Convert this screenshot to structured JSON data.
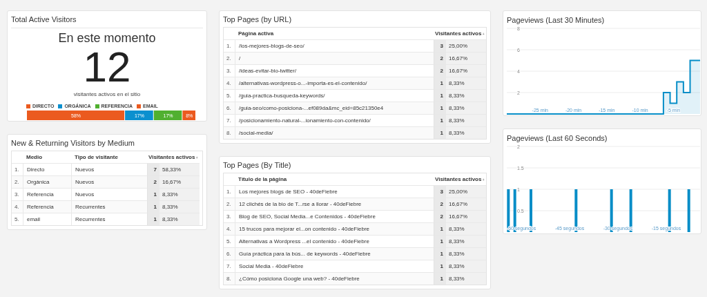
{
  "total_active": {
    "title": "Total Active Visitors",
    "heading": "En este momento",
    "count": "12",
    "caption": "visitantes activos en el sitio",
    "chart_data": {
      "type": "bar",
      "orientation": "horizontal",
      "stacked": true,
      "series": [
        {
          "name": "DIRECTO",
          "color": "#eb5a1f",
          "values": [
            58
          ],
          "value_labels": [
            "58%"
          ]
        },
        {
          "name": "ORGÁNICA",
          "color": "#0b90cf",
          "values": [
            17
          ],
          "value_labels": [
            "17%"
          ]
        },
        {
          "name": "REFERENCIA",
          "color": "#50b030",
          "values": [
            17
          ],
          "value_labels": [
            "17%"
          ]
        },
        {
          "name": "EMAIL",
          "color": "#eb5a1f",
          "values": [
            8
          ],
          "value_labels": [
            "8%"
          ]
        }
      ]
    }
  },
  "by_medium": {
    "title": "New & Returning Visitors by Medium",
    "columns": [
      "Medio",
      "Tipo de visitante",
      "Visitantes activos"
    ],
    "rows": [
      {
        "index": "1.",
        "cells": [
          "Directo",
          "Nuevos"
        ],
        "count": "7",
        "percent": "58,33%"
      },
      {
        "index": "2.",
        "cells": [
          "Orgánica",
          "Nuevos"
        ],
        "count": "2",
        "percent": "16,67%"
      },
      {
        "index": "3.",
        "cells": [
          "Referencia",
          "Nuevos"
        ],
        "count": "1",
        "percent": "8,33%"
      },
      {
        "index": "4.",
        "cells": [
          "Referencia",
          "Recurrentes"
        ],
        "count": "1",
        "percent": "8,33%"
      },
      {
        "index": "5.",
        "cells": [
          "email",
          "Recurrentes"
        ],
        "count": "1",
        "percent": "8,33%"
      }
    ]
  },
  "top_pages_url": {
    "title": "Top Pages (by URL)",
    "columns": [
      "Página activa",
      "Visitantes activos"
    ],
    "rows": [
      {
        "index": "1.",
        "cells": [
          "/los-mejores-blogs-de-seo/"
        ],
        "count": "3",
        "percent": "25,00%"
      },
      {
        "index": "2.",
        "cells": [
          "/"
        ],
        "count": "2",
        "percent": "16,67%"
      },
      {
        "index": "3.",
        "cells": [
          "/ideas-evitar-bio-twitter/"
        ],
        "count": "2",
        "percent": "16,67%"
      },
      {
        "index": "4.",
        "cells": [
          "/alternativas-wordpress-o...-importa-es-el-contenido/"
        ],
        "count": "1",
        "percent": "8,33%"
      },
      {
        "index": "5.",
        "cells": [
          "/guia-practica-busqueda-keywords/"
        ],
        "count": "1",
        "percent": "8,33%"
      },
      {
        "index": "6.",
        "cells": [
          "/guia-seo/como-posiciona-...ef089da&mc_eid=85c21350e4"
        ],
        "count": "1",
        "percent": "8,33%"
      },
      {
        "index": "7.",
        "cells": [
          "/posicionamiento-natural-...ionamiento-con-contenido/"
        ],
        "count": "1",
        "percent": "8,33%"
      },
      {
        "index": "8.",
        "cells": [
          "/social-media/"
        ],
        "count": "1",
        "percent": "8,33%"
      }
    ]
  },
  "top_pages_title": {
    "title": "Top Pages (By Title)",
    "columns": [
      "Título de la página",
      "Visitantes activos"
    ],
    "rows": [
      {
        "index": "1.",
        "cells": [
          "Los mejores blogs de SEO - 40deFiebre"
        ],
        "count": "3",
        "percent": "25,00%"
      },
      {
        "index": "2.",
        "cells": [
          "12 clichés de la bio de T...rse a llorar - 40deFiebre"
        ],
        "count": "2",
        "percent": "16,67%"
      },
      {
        "index": "3.",
        "cells": [
          "Blog de SEO, Social Media...e Contenidos - 40deFiebre"
        ],
        "count": "2",
        "percent": "16,67%"
      },
      {
        "index": "4.",
        "cells": [
          "15 trucos para mejorar el...on contenido - 40deFiebre"
        ],
        "count": "1",
        "percent": "8,33%"
      },
      {
        "index": "5.",
        "cells": [
          "Alternativas a Wordpress ...el contenido - 40deFiebre"
        ],
        "count": "1",
        "percent": "8,33%"
      },
      {
        "index": "6.",
        "cells": [
          "Guía práctica para la bús... de keywords - 40deFiebre"
        ],
        "count": "1",
        "percent": "8,33%"
      },
      {
        "index": "7.",
        "cells": [
          "Social Media - 40deFiebre"
        ],
        "count": "1",
        "percent": "8,33%"
      },
      {
        "index": "8.",
        "cells": [
          "¿Cómo posiciona Google una web? - 40deFiebre"
        ],
        "count": "1",
        "percent": "8,33%"
      }
    ]
  },
  "pageviews_30_min": {
    "title": "Pageviews (Last 30 Minutes)",
    "chart_data": {
      "type": "area",
      "xlim": [
        -30,
        -1
      ],
      "ylim": [
        0,
        8
      ],
      "grid": true,
      "yticks": [
        {
          "value": 2,
          "label": "2"
        },
        {
          "value": 4,
          "label": "4"
        },
        {
          "value": 6,
          "label": "6"
        },
        {
          "value": 8,
          "label": "8"
        }
      ],
      "x": [
        -30,
        -29,
        -28,
        -27,
        -26,
        -25,
        -24,
        -23,
        -22,
        -21,
        -20,
        -19,
        -18,
        -17,
        -16,
        -15,
        -14,
        -13,
        -12,
        -11,
        -10,
        -9,
        -8,
        -7,
        -6,
        -5,
        -4,
        -3,
        -2,
        -1
      ],
      "xticks": [
        {
          "value": -25,
          "label": "-25 min"
        },
        {
          "value": -20,
          "label": "-20 min"
        },
        {
          "value": -15,
          "label": "-15 min"
        },
        {
          "value": -10,
          "label": "-10 min"
        },
        {
          "value": -5,
          "label": "-5 min"
        }
      ],
      "series": [
        {
          "color": "#058dc7",
          "values": [
            0,
            0,
            0,
            0,
            0,
            0,
            0,
            0,
            0,
            0,
            0,
            0,
            0,
            0,
            0,
            0,
            0,
            0,
            0,
            0,
            0,
            0,
            0,
            0,
            2,
            1,
            3,
            2,
            5,
            5
          ]
        }
      ]
    }
  },
  "pageviews_60_sec": {
    "title": "Pageviews (Last 60 Seconds)",
    "chart_data": {
      "type": "bar",
      "xlim": [
        -64.5,
        -4.5
      ],
      "ylim": [
        0,
        2
      ],
      "grid": true,
      "yticks": [
        {
          "value": 0.5,
          "label": "0.5"
        },
        {
          "value": 1,
          "label": "1"
        },
        {
          "value": 1.5,
          "label": "1.5"
        },
        {
          "value": 2,
          "label": "2"
        }
      ],
      "x": [
        -64,
        -62,
        -57,
        -43,
        -32,
        -26,
        -14,
        -8
      ],
      "xticks": [
        {
          "value": -60,
          "label": "-60 segundos"
        },
        {
          "value": -45,
          "label": "-45 segundos"
        },
        {
          "value": -30,
          "label": "-30 segundos"
        },
        {
          "value": -15,
          "label": "-15 segundos"
        }
      ],
      "series": [
        {
          "color": "#058dc7",
          "values": [
            1,
            1,
            1,
            1,
            1,
            1,
            1,
            1
          ]
        }
      ]
    }
  }
}
